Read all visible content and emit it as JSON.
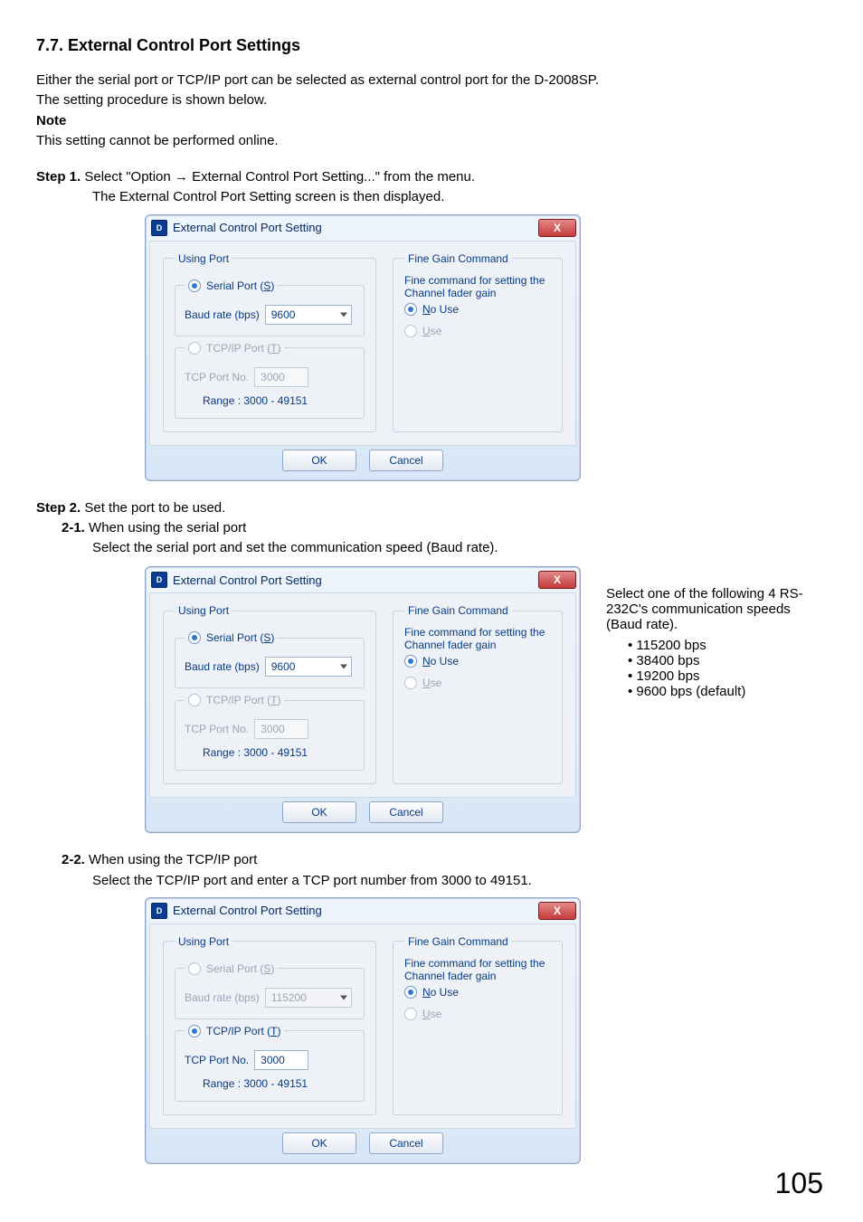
{
  "heading": "7.7. External Control Port Settings",
  "intro1": "Either the serial port or TCP/IP port can be selected as external control port for the D-2008SP.",
  "intro2": "The setting procedure is shown below.",
  "note_label": "Note",
  "note_body": "This setting cannot be performed online.",
  "step1_label": "Step 1.",
  "step1_line1": "Select \"Option  →  External Control Port Setting...\" from the menu.",
  "step1_line2": "The External Control Port Setting screen is then displayed.",
  "step2_label": "Step 2.",
  "step2_line1": "Set the port to be used.",
  "step21_label": "2-1.",
  "step21_line1": "When using the serial port",
  "step21_line2": "Select the serial port and set the communication speed (Baud rate).",
  "step22_label": "2-2.",
  "step22_line1": "When using the TCP/IP port",
  "step22_line2": "Select the TCP/IP port and enter a TCP port number from 3000 to 49151.",
  "page_number": "105",
  "side_text_intro": "Select one of the following 4 RS-232C's communication speeds (Baud rate).",
  "side_list": [
    "115200 bps",
    "38400 bps",
    "19200 bps",
    "9600 bps (default)"
  ],
  "dialogA": {
    "title": "External Control Port Setting",
    "close": "X",
    "using_port_legend": "Using Port",
    "serial_label_pre": "Serial Port (",
    "serial_letter": "S",
    "serial_label_post": ")",
    "serial_selected": true,
    "baud_label": "Baud rate (bps)",
    "baud_value": "9600",
    "baud_enabled": true,
    "tcp_label_pre": "TCP/IP Port (",
    "tcp_letter": "T",
    "tcp_label_post": ")",
    "tcp_selected": false,
    "tcp_port_label": "TCP Port No.",
    "tcp_port_value": "3000",
    "tcp_enabled": false,
    "range_label": "Range : 3000 - 49151",
    "fine_legend": "Fine Gain Command",
    "fine_desc1": "Fine command for setting the",
    "fine_desc2": "Channel fader gain",
    "no_use_letter": "N",
    "no_use_rest": "o Use",
    "no_use_selected": true,
    "use_letter": "U",
    "use_rest": "se",
    "use_selected": false,
    "ok": "OK",
    "cancel": "Cancel"
  },
  "dialogB": {
    "title": "External Control Port Setting",
    "close": "X",
    "using_port_legend": "Using Port",
    "serial_label_pre": "Serial Port (",
    "serial_letter": "S",
    "serial_label_post": ")",
    "serial_selected": true,
    "baud_label": "Baud rate (bps)",
    "baud_value": "9600",
    "baud_enabled": true,
    "tcp_label_pre": "TCP/IP Port (",
    "tcp_letter": "T",
    "tcp_label_post": ")",
    "tcp_selected": false,
    "tcp_port_label": "TCP Port No.",
    "tcp_port_value": "3000",
    "tcp_enabled": false,
    "range_label": "Range : 3000 - 49151",
    "fine_legend": "Fine Gain Command",
    "fine_desc1": "Fine command for setting the",
    "fine_desc2": "Channel fader gain",
    "no_use_letter": "N",
    "no_use_rest": "o Use",
    "no_use_selected": true,
    "use_letter": "U",
    "use_rest": "se",
    "use_selected": false,
    "ok": "OK",
    "cancel": "Cancel"
  },
  "dialogC": {
    "title": "External Control Port Setting",
    "close": "X",
    "using_port_legend": "Using Port",
    "serial_label_pre": "Serial Port (",
    "serial_letter": "S",
    "serial_label_post": ")",
    "serial_selected": false,
    "baud_label": "Baud rate (bps)",
    "baud_value": "115200",
    "baud_enabled": false,
    "tcp_label_pre": "TCP/IP Port (",
    "tcp_letter": "T",
    "tcp_label_post": ")",
    "tcp_selected": true,
    "tcp_port_label": "TCP Port No.",
    "tcp_port_value": "3000",
    "tcp_enabled": true,
    "range_label": "Range : 3000 - 49151",
    "fine_legend": "Fine Gain Command",
    "fine_desc1": "Fine command for setting the",
    "fine_desc2": "Channel fader gain",
    "no_use_letter": "N",
    "no_use_rest": "o Use",
    "no_use_selected": true,
    "use_letter": "U",
    "use_rest": "se",
    "use_selected": false,
    "ok": "OK",
    "cancel": "Cancel"
  }
}
